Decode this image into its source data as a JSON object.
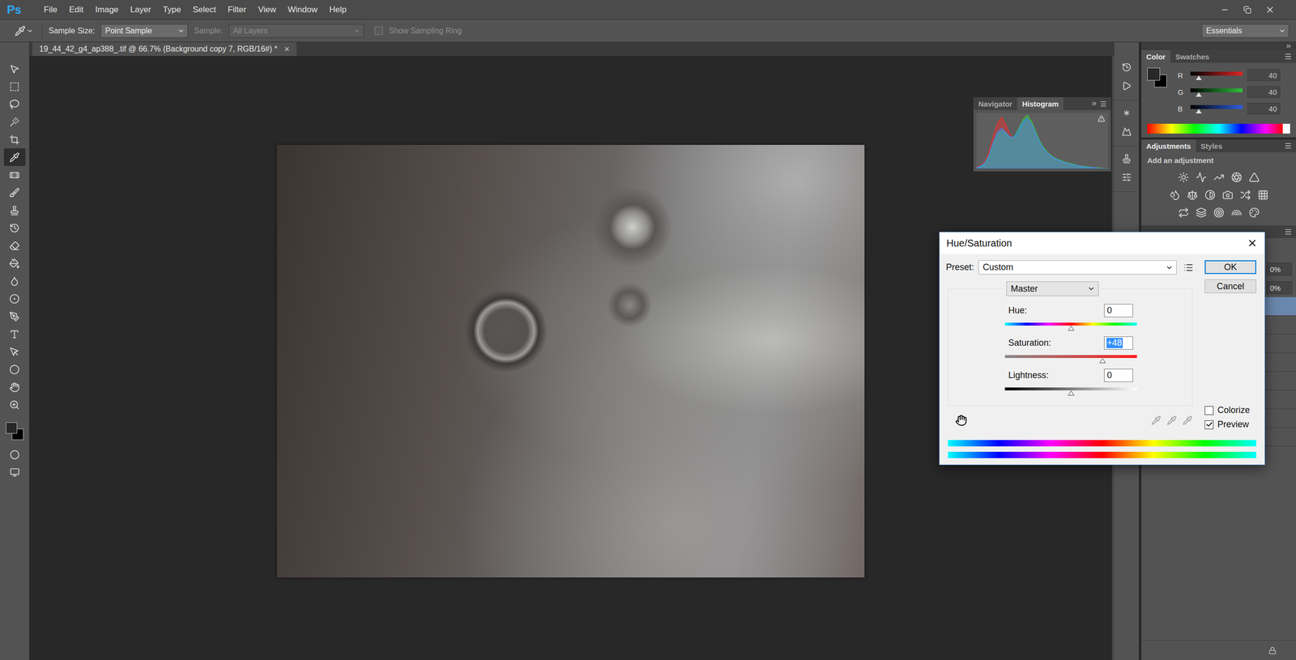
{
  "app": {
    "logo": "Ps"
  },
  "menu": [
    "File",
    "Edit",
    "Image",
    "Layer",
    "Type",
    "Select",
    "Filter",
    "View",
    "Window",
    "Help"
  ],
  "options_bar": {
    "sample_size": {
      "label": "Sample Size:",
      "value": "Point Sample",
      "disabled": false
    },
    "sample": {
      "label": "Sample:",
      "value": "All Layers",
      "disabled": true
    },
    "sampling_ring": {
      "label": "Show Sampling Ring",
      "checked": false,
      "disabled": true
    },
    "workspace": "Essentials"
  },
  "tools": [
    {
      "selected": false
    },
    {
      "selected": false
    },
    {
      "selected": false
    },
    {
      "selected": false
    },
    {
      "selected": false
    },
    {
      "selected": true
    },
    {
      "selected": false
    },
    {
      "selected": false
    },
    {
      "selected": false
    },
    {
      "selected": false
    },
    {
      "selected": false
    },
    {
      "selected": false
    },
    {
      "selected": false
    },
    {
      "selected": false
    },
    {
      "selected": false
    },
    {
      "selected": false
    },
    {
      "selected": false
    },
    {
      "selected": false
    },
    {
      "selected": false
    },
    {
      "selected": false
    }
  ],
  "document": {
    "tab": "19_44_42_g4_ap388_.tif @ 66.7% (Background copy 7, RGB/16#) *",
    "close": "×"
  },
  "histogram_panel": {
    "tabs": [
      {
        "label": "Navigator",
        "selected": false
      },
      {
        "label": "Histogram",
        "selected": true
      }
    ],
    "chart": {
      "series": [
        {
          "color": "#e8322e",
          "values": [
            2,
            5,
            12,
            30,
            60,
            82,
            92,
            78,
            60,
            52,
            58,
            75,
            86,
            80,
            62,
            45,
            33,
            25,
            19,
            15,
            12,
            10,
            8,
            6,
            5,
            4,
            3,
            2,
            1,
            1,
            0,
            0
          ]
        },
        {
          "color": "#3fc24a",
          "values": [
            1,
            3,
            8,
            20,
            42,
            60,
            68,
            62,
            55,
            58,
            72,
            88,
            96,
            85,
            66,
            48,
            36,
            27,
            21,
            17,
            14,
            11,
            9,
            7,
            5,
            4,
            3,
            2,
            1,
            1,
            0,
            0
          ]
        },
        {
          "color": "#3a8ef0",
          "values": [
            1,
            4,
            10,
            24,
            48,
            66,
            72,
            64,
            56,
            57,
            70,
            84,
            90,
            80,
            62,
            46,
            34,
            26,
            20,
            16,
            13,
            10,
            8,
            6,
            5,
            3,
            2,
            2,
            1,
            0,
            0,
            0
          ]
        }
      ]
    }
  },
  "color_panel": {
    "tabs": [
      {
        "label": "Color",
        "selected": true
      },
      {
        "label": "Swatches",
        "selected": false
      }
    ],
    "channels": [
      {
        "name": "R",
        "value": "40",
        "level": 0.157,
        "color": "#e02424"
      },
      {
        "name": "G",
        "value": "40",
        "level": 0.157,
        "color": "#2fbf3a"
      },
      {
        "name": "B",
        "value": "40",
        "level": 0.157,
        "color": "#2d5fe0"
      }
    ]
  },
  "adjustments_panel": {
    "tabs": [
      {
        "label": "Adjustments",
        "selected": true
      },
      {
        "label": "Styles",
        "selected": false
      }
    ],
    "hint": "Add an adjustment"
  },
  "layers_panel": {
    "fields": [
      "0%",
      "0%"
    ],
    "layers": [
      {
        "selected": true
      },
      {
        "selected": false
      },
      {
        "selected": false
      },
      {
        "selected": false
      },
      {
        "selected": false
      },
      {
        "selected": false
      },
      {
        "selected": false
      },
      {
        "selected": false
      }
    ]
  },
  "dialog": {
    "title": "Hue/Saturation",
    "preset": {
      "label": "Preset:",
      "value": "Custom"
    },
    "buttons": [
      {
        "label": "OK",
        "default": true
      },
      {
        "label": "Cancel",
        "default": false
      }
    ],
    "channel": "Master",
    "sliders": [
      {
        "label": "Hue:",
        "value": "0",
        "level": 0.5,
        "kind": "hue",
        "selected": false
      },
      {
        "label": "Saturation:",
        "value": "+48",
        "level": 0.74,
        "kind": "saturation",
        "selected": true
      },
      {
        "label": "Lightness:",
        "value": "0",
        "level": 0.5,
        "kind": "lightness",
        "selected": false
      }
    ],
    "eyedroppers": [
      {
        "disabled": true
      },
      {
        "disabled": true
      },
      {
        "disabled": true
      }
    ],
    "checkboxes": [
      {
        "label": "Colorize",
        "checked": false
      },
      {
        "label": "Preview",
        "checked": true
      }
    ]
  }
}
